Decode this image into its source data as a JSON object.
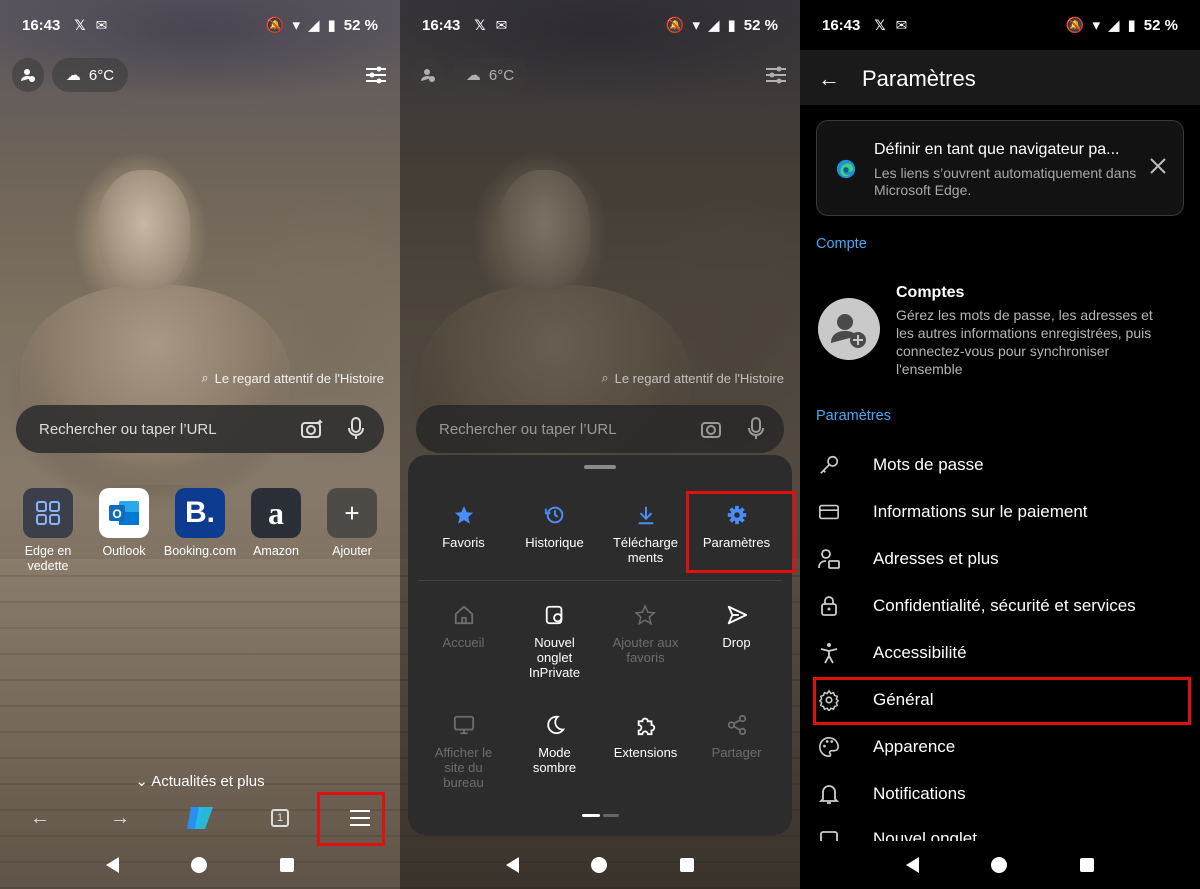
{
  "status": {
    "time": "16:43",
    "battery": "52 %"
  },
  "home": {
    "temperature": "6°C",
    "image_caption": "Le regard attentif de l'Histoire",
    "search_placeholder": "Rechercher ou taper l’URL",
    "tiles": [
      {
        "label": "Edge en vedette"
      },
      {
        "label": "Outlook"
      },
      {
        "label": "Booking.com",
        "glyph": "B."
      },
      {
        "label": "Amazon",
        "glyph": "a"
      },
      {
        "label": "Ajouter",
        "glyph": "+"
      }
    ],
    "news": "Actualités et plus",
    "tab_count": "1"
  },
  "menu": {
    "row1": [
      {
        "label": "Favoris",
        "icon": "star-icon"
      },
      {
        "label": "Historique",
        "icon": "history-icon"
      },
      {
        "label": "Télécharge ments",
        "icon": "download-icon"
      },
      {
        "label": "Paramètres",
        "icon": "gear-icon"
      }
    ],
    "row2": [
      {
        "label": "Accueil",
        "icon": "home-icon",
        "disabled": true
      },
      {
        "label": "Nouvel onglet InPrivate",
        "icon": "inprivate-icon"
      },
      {
        "label": "Ajouter aux favoris",
        "icon": "add-favorite-icon",
        "disabled": true
      },
      {
        "label": "Drop",
        "icon": "send-icon"
      }
    ],
    "row3": [
      {
        "label": "Afficher le site du bureau",
        "icon": "desktop-icon",
        "disabled": true
      },
      {
        "label": "Mode sombre",
        "icon": "moon-icon"
      },
      {
        "label": "Extensions",
        "icon": "puzzle-icon"
      },
      {
        "label": "Partager",
        "icon": "share-icon",
        "disabled": true
      }
    ]
  },
  "settings": {
    "title": "Paramètres",
    "default_card": {
      "title": "Définir en tant que navigateur pa...",
      "subtitle": "Les liens s’ouvrent automatiquement dans Microsoft Edge."
    },
    "section_account": "Compte",
    "account": {
      "title": "Comptes",
      "subtitle": "Gérez les mots de passe, les adresses et les autres informations enregistrées, puis connectez-vous pour synchroniser l'ensemble"
    },
    "section_settings": "Paramètres",
    "items": [
      {
        "label": "Mots de passe",
        "icon": "key-icon"
      },
      {
        "label": "Informations sur le paiement",
        "icon": "card-icon"
      },
      {
        "label": "Adresses et plus",
        "icon": "address-icon"
      },
      {
        "label": "Confidentialité, sécurité et services",
        "icon": "lock-icon"
      },
      {
        "label": "Accessibilité",
        "icon": "accessibility-icon"
      },
      {
        "label": "Général",
        "icon": "gear-icon"
      },
      {
        "label": "Apparence",
        "icon": "palette-icon"
      },
      {
        "label": "Notifications",
        "icon": "bell-icon"
      },
      {
        "label": "Nouvel onglet",
        "icon": "tab-icon"
      }
    ]
  }
}
